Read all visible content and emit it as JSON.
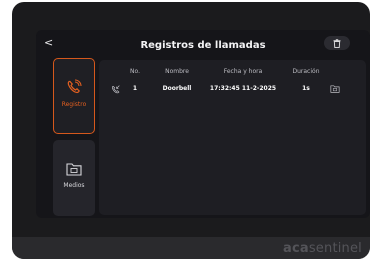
{
  "screen": {
    "title": "Registros de llamadas",
    "back_label": "<"
  },
  "sidebar": {
    "items": [
      {
        "label": "Registro",
        "icon": "phone-call-icon",
        "active": true
      },
      {
        "label": "Medios",
        "icon": "folder-media-icon",
        "active": false
      }
    ]
  },
  "table": {
    "columns": [
      "No.",
      "Nombre",
      "Fecha y hora",
      "Duración"
    ],
    "rows": [
      {
        "no": "1",
        "nombre": "Doorbell",
        "fecha": "17:32:45 11-2-2025",
        "duracion": "1s",
        "type_icon": "incoming-call-icon",
        "media_icon": "media-folder-icon"
      }
    ]
  },
  "device": {
    "brand_bold": "aca",
    "brand_light": "sentinel"
  },
  "colors": {
    "accent": "#e25f20",
    "screen_bg": "#151519",
    "panel_bg": "#1e1e23",
    "bezel": "#1b1b1d"
  }
}
